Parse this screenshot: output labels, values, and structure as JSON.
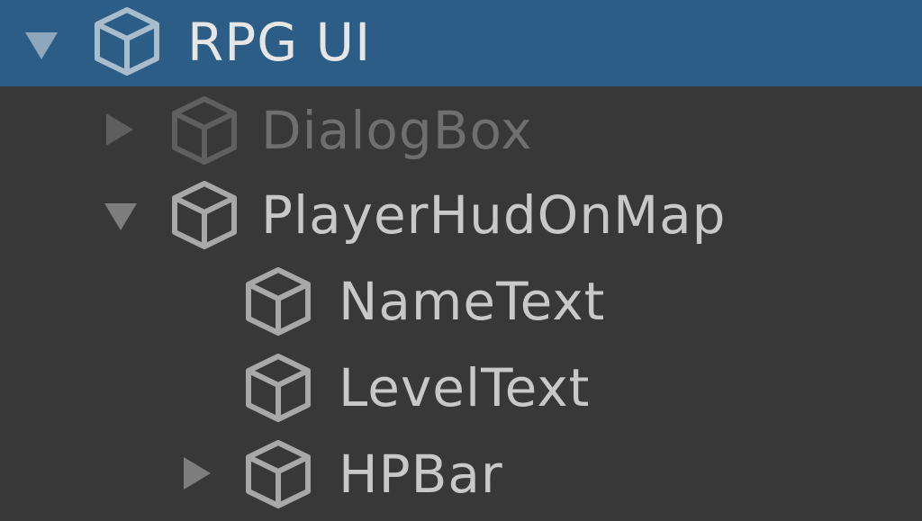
{
  "hierarchy": {
    "items": [
      {
        "label": "RPG UI",
        "icon": "cube-icon",
        "expanded": true,
        "selected": true,
        "active": true
      },
      {
        "label": "DialogBox",
        "icon": "cube-icon",
        "expanded": false,
        "active": false
      },
      {
        "label": "PlayerHudOnMap",
        "icon": "cube-icon",
        "expanded": true,
        "active": true
      },
      {
        "label": "NameText",
        "icon": "cube-icon",
        "active": true
      },
      {
        "label": "LevelText",
        "icon": "cube-icon",
        "active": true
      },
      {
        "label": "HPBar",
        "icon": "cube-icon",
        "expanded": false,
        "active": true
      }
    ]
  },
  "colors": {
    "background": "#383838",
    "selection": "#2c5d87",
    "text": "#c8c8c8",
    "text_inactive": "#6f6f6f"
  }
}
